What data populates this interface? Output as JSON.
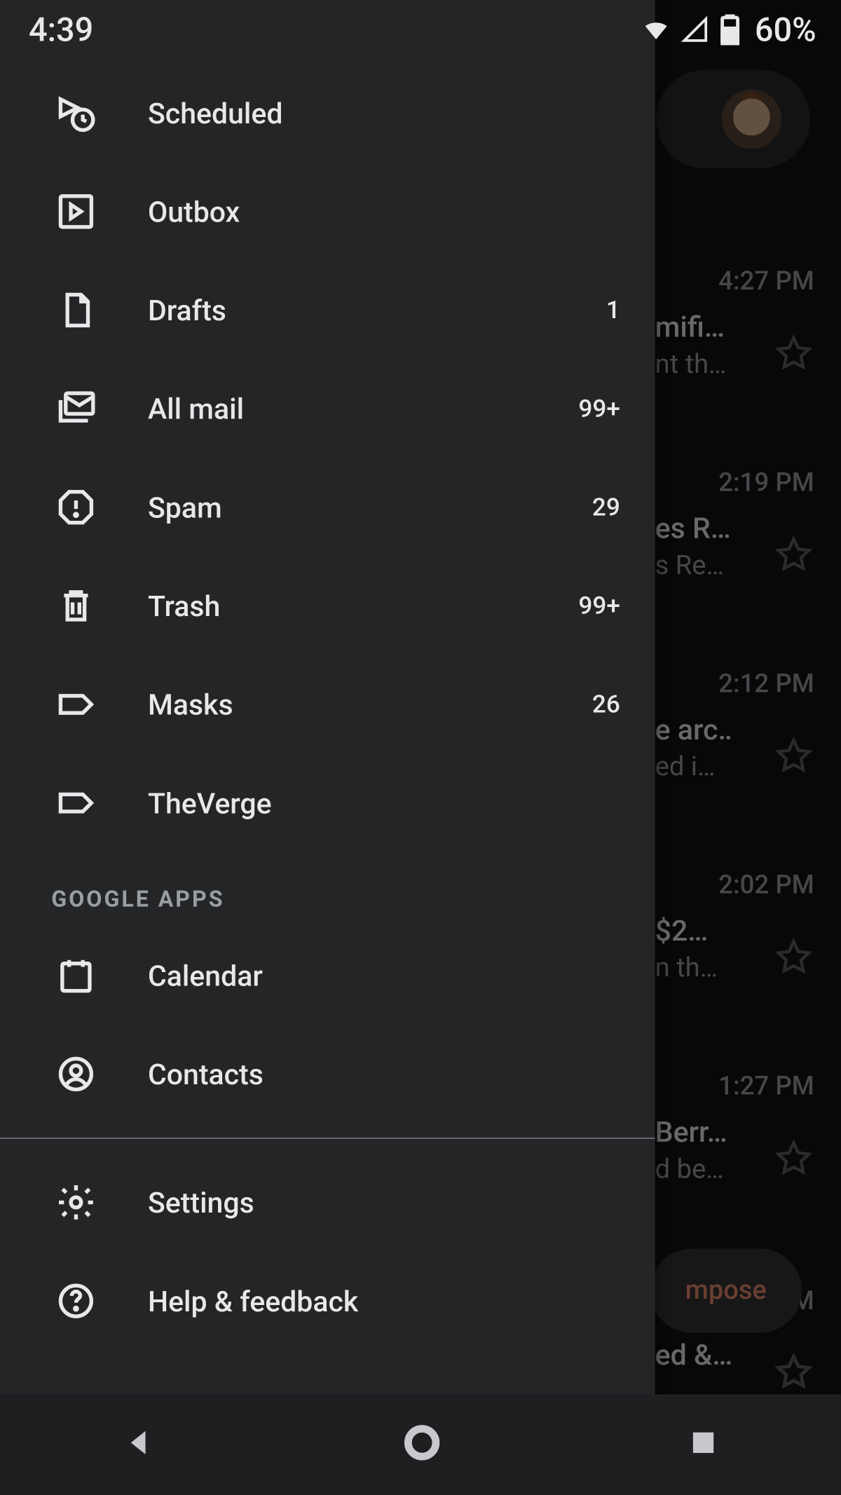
{
  "status_bar": {
    "time": "4:39",
    "battery_percent": "60%"
  },
  "drawer": {
    "folders": [
      {
        "label": "Scheduled",
        "count": ""
      },
      {
        "label": "Outbox",
        "count": ""
      },
      {
        "label": "Drafts",
        "count": "1"
      },
      {
        "label": "All mail",
        "count": "99+"
      },
      {
        "label": "Spam",
        "count": "29"
      },
      {
        "label": "Trash",
        "count": "99+"
      },
      {
        "label": "Masks",
        "count": "26"
      },
      {
        "label": "TheVerge",
        "count": ""
      }
    ],
    "section_apps_header": "GOOGLE APPS",
    "apps": [
      {
        "label": "Calendar"
      },
      {
        "label": "Contacts"
      }
    ],
    "footer": [
      {
        "label": "Settings"
      },
      {
        "label": "Help & feedback"
      }
    ]
  },
  "inbox": {
    "messages": [
      {
        "time": "4:27 PM",
        "subject": "mifi…",
        "preview": "nt th…"
      },
      {
        "time": "2:19 PM",
        "subject": "es R…",
        "preview": "s Re…"
      },
      {
        "time": "2:12 PM",
        "subject": "e arc…",
        "preview": "ed i…"
      },
      {
        "time": "2:02 PM",
        "subject": "$2…",
        "preview": "n th…"
      },
      {
        "time": "1:27 PM",
        "subject": "Berr…",
        "preview": "d be…"
      }
    ],
    "compose_label": "mpose",
    "last_time": "M",
    "last_subject": "ed &…"
  }
}
